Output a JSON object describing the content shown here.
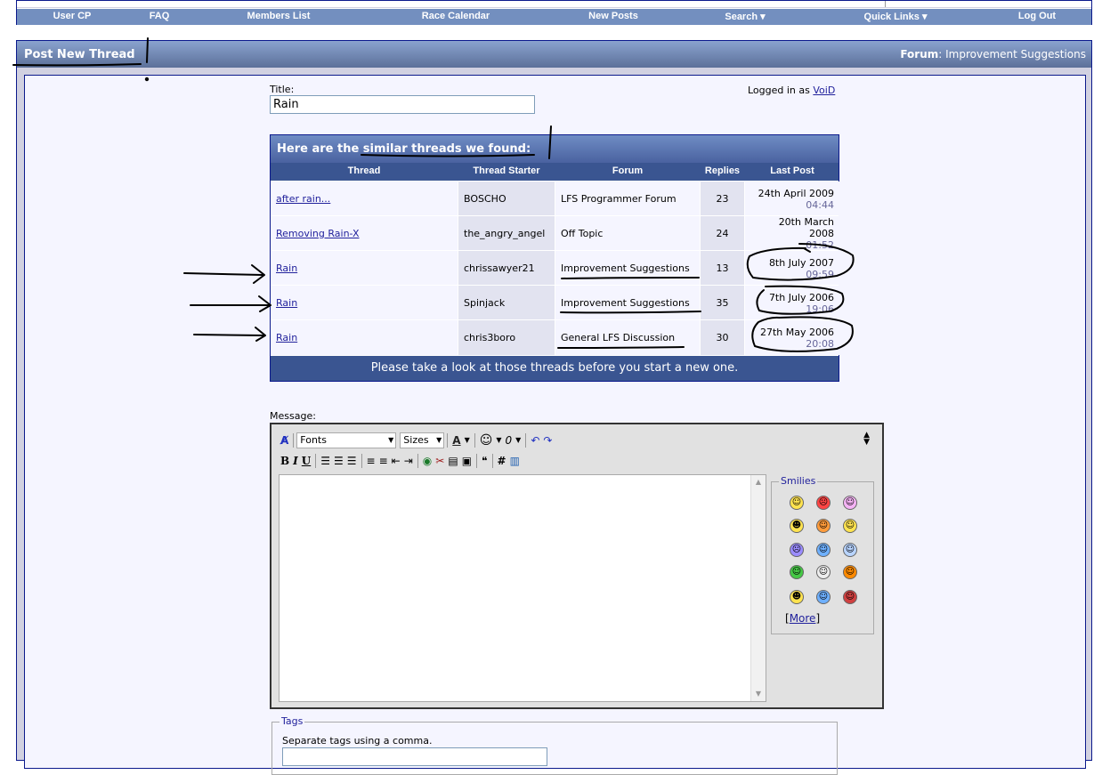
{
  "navbar": {
    "items": [
      "User CP",
      "FAQ",
      "Members List",
      "Race Calendar",
      "New Posts",
      "Search ▾",
      "Quick Links ▾",
      "Log Out"
    ]
  },
  "panel": {
    "title": "Post New Thread",
    "forum_label": "Forum",
    "forum_name": "Improvement Suggestions"
  },
  "form": {
    "title_label": "Title:",
    "title_value": "Rain",
    "logged_in_prefix": "Logged in as",
    "username": "VoiD"
  },
  "similar": {
    "header": "Here are the similar threads we found:",
    "columns": [
      "Thread",
      "Thread Starter",
      "Forum",
      "Replies",
      "Last Post"
    ],
    "rows": [
      {
        "thread": "after rain...",
        "starter": "BOSCHO",
        "forum": "LFS Programmer Forum",
        "replies": "23",
        "date": "24th April 2009",
        "time": "04:44"
      },
      {
        "thread": "Removing Rain-X",
        "starter": "the_angry_angel",
        "forum": "Off Topic",
        "replies": "24",
        "date": "20th March 2008",
        "time": "01:52"
      },
      {
        "thread": "Rain",
        "starter": "chrissawyer21",
        "forum": "Improvement Suggestions",
        "replies": "13",
        "date": "8th July 2007",
        "time": "09:59"
      },
      {
        "thread": "Rain",
        "starter": "Spinjack",
        "forum": "Improvement Suggestions",
        "replies": "35",
        "date": "7th July 2006",
        "time": "19:06"
      },
      {
        "thread": "Rain",
        "starter": "chris3boro",
        "forum": "General LFS Discussion",
        "replies": "30",
        "date": "27th May 2006",
        "time": "20:08"
      }
    ],
    "footer": "Please take a look at those threads before you start a new one."
  },
  "editor": {
    "message_label": "Message:",
    "fonts_label": "Fonts",
    "sizes_label": "Sizes",
    "smilies_legend": "Smilies",
    "more_link": "More",
    "smiley_colors": [
      "#ffe34f",
      "#ff4444",
      "#f5b3f5",
      "#ffe34f",
      "#ff9b3a",
      "#ffe34f",
      "#9a8cff",
      "#6eb0ff",
      "#b8d4ff",
      "#45c845",
      "#eeeeee",
      "#ff8a00",
      "#ffe34f",
      "#6eb0ff",
      "#d04040"
    ]
  },
  "tags": {
    "legend": "Tags",
    "hint": "Separate tags using a comma."
  }
}
